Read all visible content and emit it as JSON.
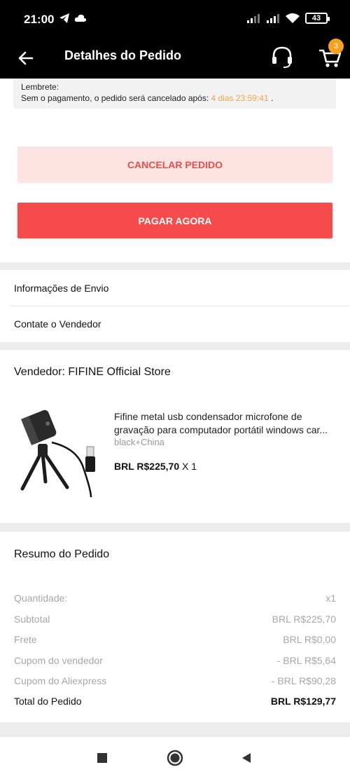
{
  "status_bar": {
    "time": "21:00",
    "battery": "43"
  },
  "header": {
    "title": "Detalhes do Pedido",
    "cart_count": "3"
  },
  "reminder": {
    "label": "Lembrete:",
    "text": "Sem o pagamento, o pedido será cancelado após: ",
    "time": "4 dias 23:59:41",
    "suffix": " ."
  },
  "actions": {
    "cancel_label": "CANCELAR PEDIDO",
    "pay_label": "PAGAR AGORA"
  },
  "links": {
    "shipping_info": "Informações de Envio",
    "contact_seller": "Contate o Vendedor"
  },
  "seller": {
    "name": "Vendedor: FIFINE Official Store"
  },
  "product": {
    "title_line1": "Fifine metal usb condensador microfone de",
    "title_line2": "gravação para computador portátil windows car...",
    "variant": "black+China",
    "price": "BRL R$225,70",
    "quantity": " X 1"
  },
  "summary": {
    "title": "Resumo do Pedido",
    "rows": [
      {
        "label": "Quantidade:",
        "value": "x1"
      },
      {
        "label": "Subtotal",
        "value": "BRL R$225,70"
      },
      {
        "label": "Frete",
        "value": "BRL R$0,00"
      },
      {
        "label": "Cupom do vendedor",
        "value": "- BRL R$5,64"
      },
      {
        "label": "Cupom do Aliexpress",
        "value": "- BRL R$90,28"
      }
    ],
    "total_label": "Total do Pedido",
    "total_value": "BRL R$129,77"
  },
  "colors": {
    "accent_red": "#f74b4b",
    "cancel_bg": "#fde3e1",
    "timer_orange": "#f6a34a",
    "badge_orange": "#f6a21d"
  },
  "icons": {
    "back": "arrow-left-icon",
    "support": "headset-icon",
    "cart": "cart-icon"
  }
}
